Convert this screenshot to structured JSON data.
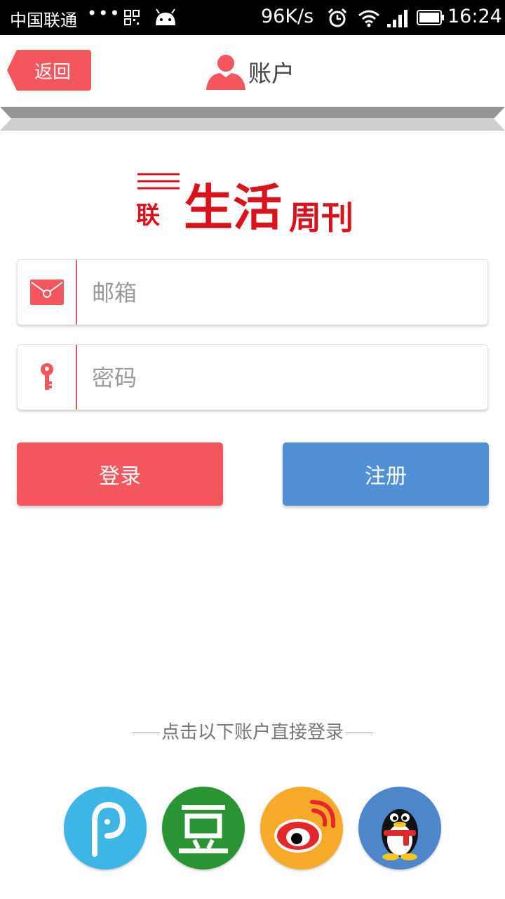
{
  "status_bar": {
    "carrier": "中国联通",
    "dots": "•••",
    "speed": "96K/s",
    "time": "16:24"
  },
  "header": {
    "back_label": "返回",
    "title": "账户"
  },
  "logo": {
    "prefix": "联",
    "main": "生活",
    "suffix": "周刊"
  },
  "form": {
    "email_placeholder": "邮箱",
    "password_placeholder": "密码",
    "login_label": "登录",
    "register_label": "注册"
  },
  "third_party": {
    "label": "点击以下账户直接登录",
    "providers": [
      {
        "icon": "p-circle-icon",
        "color": "#3db6e6"
      },
      {
        "icon": "douban-icon",
        "color": "#2a9334"
      },
      {
        "icon": "weibo-icon",
        "color": "#f7a92a"
      },
      {
        "icon": "qq-penguin-icon",
        "color": "#4d86c9"
      }
    ]
  },
  "colors": {
    "accent_red": "#f3565d",
    "accent_blue": "#5190d4"
  }
}
